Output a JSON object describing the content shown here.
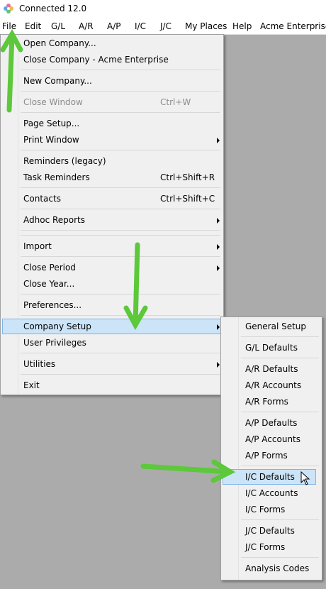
{
  "window": {
    "title": "Connected 12.0",
    "icon": "connected-app-logo-icon"
  },
  "menubar": {
    "items": [
      "File",
      "Edit",
      "G/L",
      "A/R",
      "A/P",
      "I/C",
      "J/C",
      "My Places",
      "Help",
      "Acme Enterprise"
    ]
  },
  "file_menu": {
    "open_company": "Open Company...",
    "close_company": "Close Company - Acme Enterprise",
    "new_company": "New Company...",
    "close_window": "Close Window",
    "close_window_shortcut": "Ctrl+W",
    "page_setup": "Page Setup...",
    "print_window": "Print Window",
    "reminders": "Reminders (legacy)",
    "task_reminders": "Task Reminders",
    "task_reminders_shortcut": "Ctrl+Shift+R",
    "contacts": "Contacts",
    "contacts_shortcut": "Ctrl+Shift+C",
    "adhoc_reports": "Adhoc Reports",
    "import": "Import",
    "close_period": "Close Period",
    "close_year": "Close Year...",
    "preferences": "Preferences...",
    "company_setup": "Company Setup",
    "user_privileges": "User Privileges",
    "utilities": "Utilities",
    "exit": "Exit"
  },
  "company_setup_submenu": {
    "general_setup": "General Setup",
    "gl_defaults": "G/L Defaults",
    "ar_defaults": "A/R Defaults",
    "ar_accounts": "A/R Accounts",
    "ar_forms": "A/R Forms",
    "ap_defaults": "A/P Defaults",
    "ap_accounts": "A/P Accounts",
    "ap_forms": "A/P Forms",
    "ic_defaults": "I/C Defaults",
    "ic_accounts": "I/C Accounts",
    "ic_forms": "I/C Forms",
    "jc_defaults": "J/C Defaults",
    "jc_forms": "J/C Forms",
    "analysis_codes": "Analysis Codes"
  },
  "colors": {
    "highlight_bg": "#cce4f7",
    "highlight_border": "#7eb4ea",
    "annotation_arrow": "#5cc83a",
    "desktop_bg": "#ababab"
  }
}
